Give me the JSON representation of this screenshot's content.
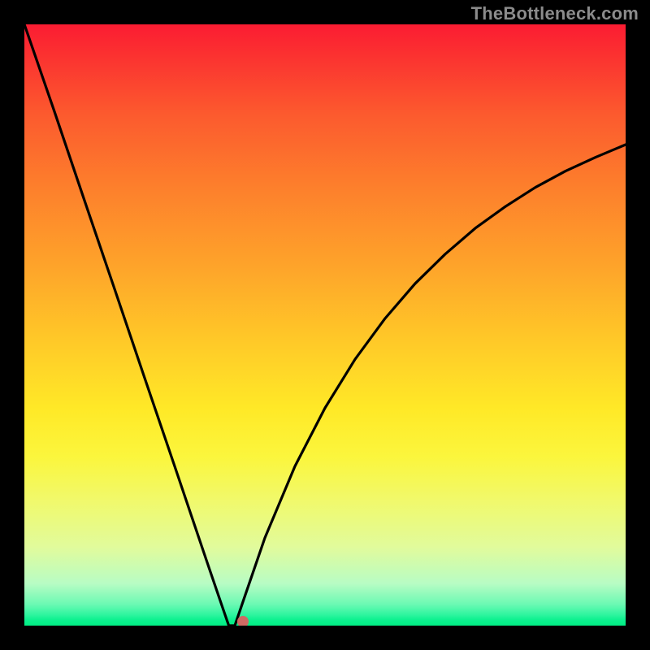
{
  "watermark": "TheBottleneck.com",
  "chart_data": {
    "type": "line",
    "title": "",
    "xlabel": "",
    "ylabel": "",
    "x_range": [
      0,
      100
    ],
    "y_range": [
      0,
      100
    ],
    "x": [
      0,
      5,
      10,
      15,
      20,
      25,
      30,
      31.5,
      33,
      34,
      35,
      36.5,
      40,
      45,
      50,
      55,
      60,
      65,
      70,
      75,
      80,
      85,
      90,
      95,
      100
    ],
    "y": [
      100,
      85.5,
      70.7,
      56,
      41.2,
      26.5,
      11.7,
      7.3,
      2.9,
      0,
      0,
      4.4,
      14.6,
      26.5,
      36.2,
      44.3,
      51.1,
      56.9,
      61.8,
      66.1,
      69.7,
      72.9,
      75.6,
      77.9,
      80.0
    ],
    "valley_flat_x": [
      33.8,
      35.2
    ],
    "marker": {
      "x": 36.3,
      "y": 0.7,
      "color": "#cf6a63"
    },
    "background_gradient": {
      "top": "#fb1c32",
      "bottom": "#00ee84"
    },
    "curve_color": "#000000"
  }
}
